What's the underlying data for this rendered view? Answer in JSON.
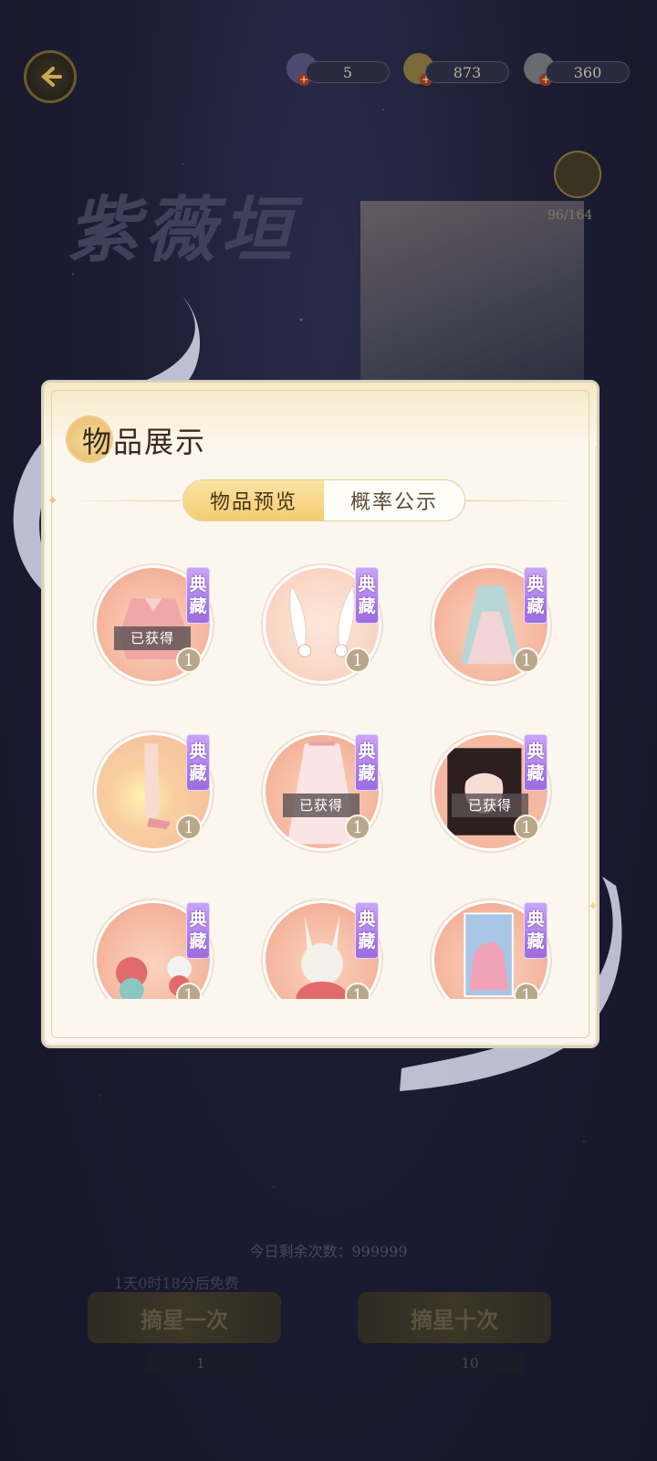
{
  "header": {
    "currencies": [
      {
        "icon": "ticket-icon",
        "value": "5"
      },
      {
        "icon": "gold-ingot-icon",
        "value": "873"
      },
      {
        "icon": "pearl-icon",
        "value": "360"
      }
    ],
    "progress": "96/164"
  },
  "background": {
    "title": "紫薇垣",
    "remaining_label": "今日剩余次数：999999",
    "free_timer": "1天0时18分后免费",
    "pull_once": "摘星一次",
    "pull_ten": "摘星十次",
    "cost_once": "1",
    "cost_ten": "10"
  },
  "modal": {
    "title": "物品展示",
    "tabs": [
      {
        "label": "物品预览",
        "active": true
      },
      {
        "label": "概率公示",
        "active": false
      }
    ],
    "tag_label_top": "典",
    "tag_label_bottom": "藏",
    "obtained_label": "已获得",
    "items": [
      {
        "name": "pink-jacket",
        "count": "1",
        "obtained": true
      },
      {
        "name": "rabbit-ear-hairpiece",
        "count": "1",
        "obtained": false
      },
      {
        "name": "blue-pink-gown",
        "count": "1",
        "obtained": false
      },
      {
        "name": "glowing-shoes",
        "count": "1",
        "obtained": false
      },
      {
        "name": "lace-skirt",
        "count": "1",
        "obtained": true
      },
      {
        "name": "long-black-hair",
        "count": "1",
        "obtained": true
      },
      {
        "name": "rabbit-ornaments",
        "count": "1",
        "obtained": false
      },
      {
        "name": "rabbit-plush",
        "count": "1",
        "obtained": false
      },
      {
        "name": "card-illustration",
        "count": "1",
        "obtained": false
      }
    ]
  },
  "colors": {
    "accent_gold": "#f4cd73",
    "tag_purple": "#9c6cdf",
    "item_peach": "#f5b8a0"
  }
}
